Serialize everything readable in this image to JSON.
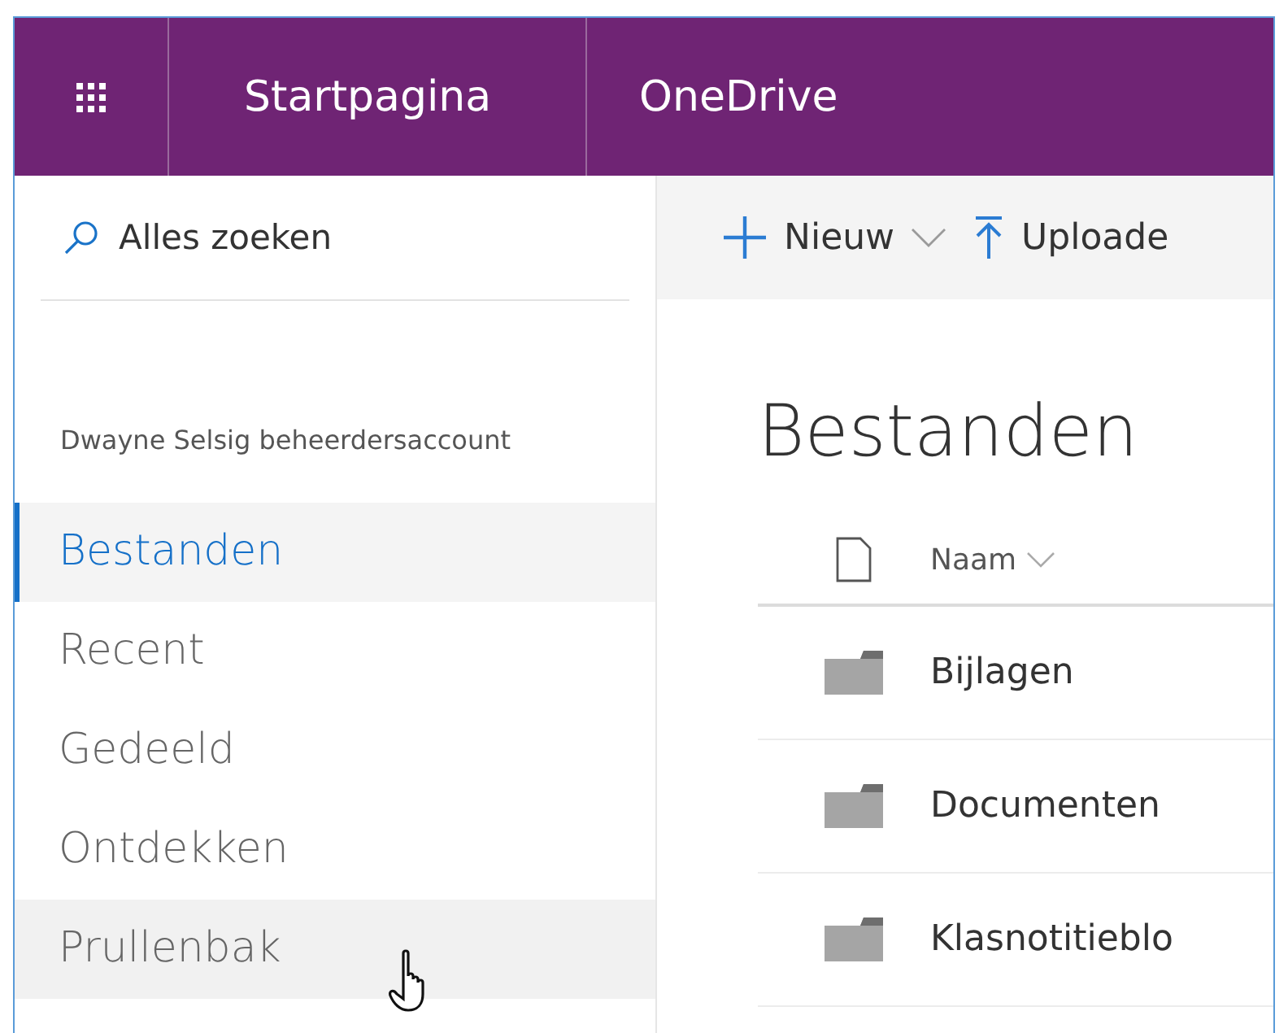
{
  "header": {
    "items": [
      "Startpagina",
      "OneDrive"
    ]
  },
  "search": {
    "placeholder": "Alles zoeken"
  },
  "account": "Dwayne Selsig beheerdersaccount",
  "nav": [
    {
      "label": "Bestanden",
      "selected": true,
      "hovered": false
    },
    {
      "label": "Recent",
      "selected": false,
      "hovered": false
    },
    {
      "label": "Gedeeld",
      "selected": false,
      "hovered": false
    },
    {
      "label": "Ontdekken",
      "selected": false,
      "hovered": false
    },
    {
      "label": "Prullenbak",
      "selected": false,
      "hovered": true
    }
  ],
  "toolbar": [
    {
      "kind": "new",
      "label": "Nieuw"
    },
    {
      "kind": "upload",
      "label": "Uploade"
    }
  ],
  "heading": "Bestanden",
  "table": {
    "columns": [
      {
        "kind": "type"
      },
      {
        "kind": "name",
        "label": "Naam"
      }
    ],
    "rows": [
      {
        "name": "Bijlagen"
      },
      {
        "name": "Documenten"
      },
      {
        "name": "Klasnotitieblo"
      }
    ]
  }
}
